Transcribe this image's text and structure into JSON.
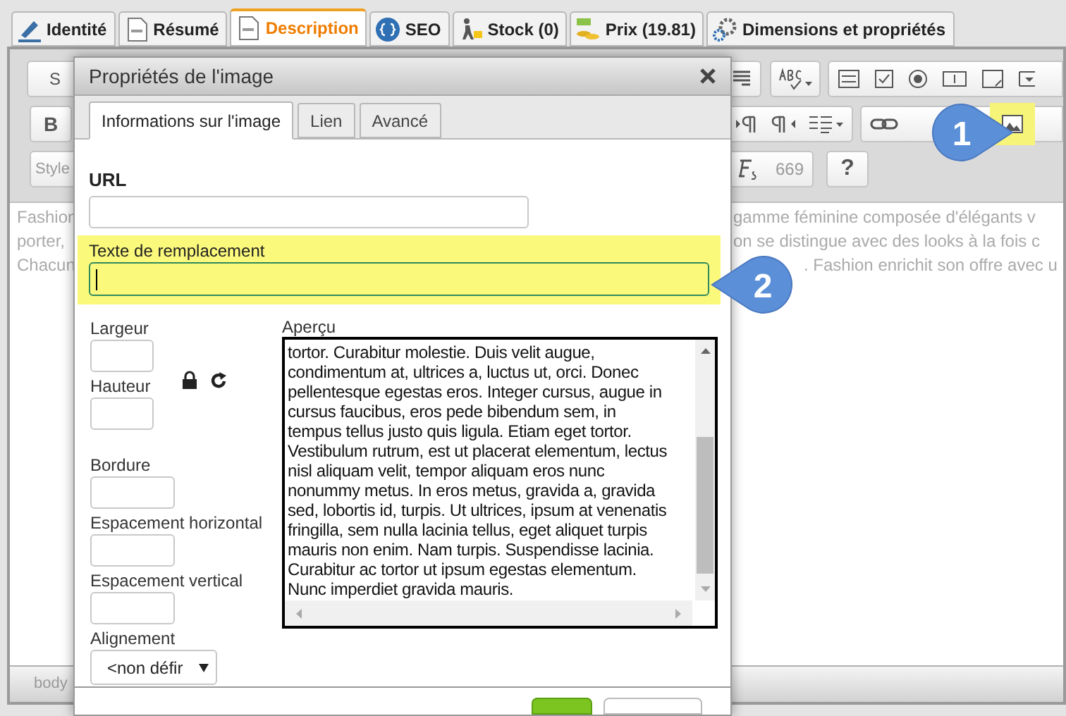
{
  "tabs": [
    {
      "label": "Identité",
      "selected": false
    },
    {
      "label": "Résumé",
      "selected": false
    },
    {
      "label": "Description",
      "selected": true
    },
    {
      "label": "SEO",
      "selected": false
    },
    {
      "label": "Stock (0)",
      "selected": false
    },
    {
      "label": "Prix (19.81)",
      "selected": false
    },
    {
      "label": "Dimensions et propriétés",
      "selected": false
    }
  ],
  "toolbar": {
    "source_button": "S",
    "bold_button": "B",
    "styles_dropdown": "Style",
    "char_count": "669",
    "help_button": "?",
    "image_button_highlighted": true
  },
  "editor_text": {
    "left_lines": [
      "Fashion",
      "porter,",
      "Chacun"
    ],
    "right_lines": [
      "gamme féminine composée d'élégants v",
      "on se distingue avec des looks à la fois c",
      ". Fashion enrichit son offre avec u"
    ]
  },
  "status_bar": "body",
  "dialog": {
    "title": "Propriétés de l'image",
    "tabs": [
      {
        "label": "Informations sur l'image",
        "selected": true
      },
      {
        "label": "Lien",
        "selected": false
      },
      {
        "label": "Avancé",
        "selected": false
      }
    ],
    "url_label": "URL",
    "alt_label": "Texte de remplacement",
    "alt_highlighted": true,
    "width_label": "Largeur",
    "height_label": "Hauteur",
    "border_label": "Bordure",
    "hspace_label": "Espacement horizontal",
    "vspace_label": "Espacement vertical",
    "align_label": "Alignement",
    "align_value": "<non défir",
    "preview_label": "Aperçu",
    "preview_lines": [
      "tortor. Curabitur molestie. Duis velit augue,",
      "condimentum at, ultrices a, luctus ut, orci. Donec",
      "pellentesque egestas eros. Integer cursus, augue in",
      "cursus faucibus, eros pede bibendum sem, in",
      "tempus tellus justo quis ligula. Etiam eget tortor.",
      "Vestibulum rutrum, est ut placerat elementum, lectus",
      "nisl aliquam velit, tempor aliquam eros nunc",
      "nonummy metus. In eros metus, gravida a, gravida",
      "sed, lobortis id, turpis. Ut ultrices, ipsum at venenatis",
      "fringilla, sem nulla lacinia tellus, eget aliquet turpis",
      "mauris non enim. Nam turpis. Suspendisse lacinia.",
      "Curabitur ac tortor ut ipsum egestas elementum.",
      "Nunc imperdiet gravida mauris."
    ]
  },
  "callouts": [
    "1",
    "2"
  ]
}
